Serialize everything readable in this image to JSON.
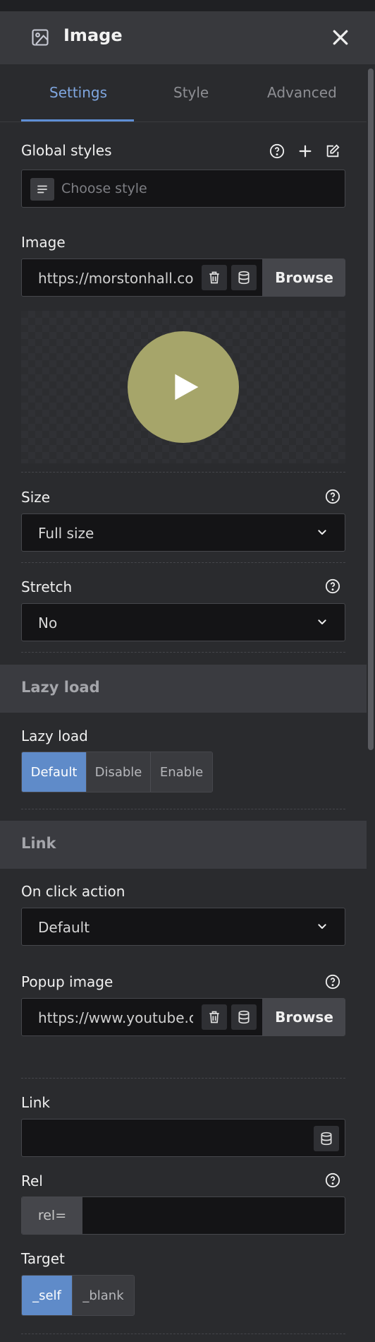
{
  "header": {
    "title": "Image"
  },
  "tabs": [
    {
      "label": "Settings"
    },
    {
      "label": "Style"
    },
    {
      "label": "Advanced"
    }
  ],
  "global_styles": {
    "label": "Global styles",
    "placeholder": "Choose style"
  },
  "image": {
    "label": "Image",
    "url": "https://morstonhall.co",
    "browse_label": "Browse"
  },
  "size": {
    "label": "Size",
    "value": "Full size"
  },
  "stretch": {
    "label": "Stretch",
    "value": "No"
  },
  "lazy_section": {
    "title": "Lazy load"
  },
  "lazy_load": {
    "label": "Lazy load",
    "options": [
      "Default",
      "Disable",
      "Enable"
    ],
    "selected": "Default"
  },
  "link_section": {
    "title": "Link"
  },
  "on_click": {
    "label": "On click action",
    "value": "Default"
  },
  "popup_image": {
    "label": "Popup image",
    "url": "https://www.youtube.c",
    "browse_label": "Browse"
  },
  "link": {
    "label": "Link",
    "value": ""
  },
  "rel": {
    "label": "Rel",
    "prefix": "rel=",
    "value": ""
  },
  "target": {
    "label": "Target",
    "options": [
      "_self",
      "_blank"
    ],
    "selected": "_self"
  },
  "colors": {
    "accent": "#5f8bc9",
    "tab_active": "#7fa6df",
    "play_button": "#a6a56a"
  }
}
